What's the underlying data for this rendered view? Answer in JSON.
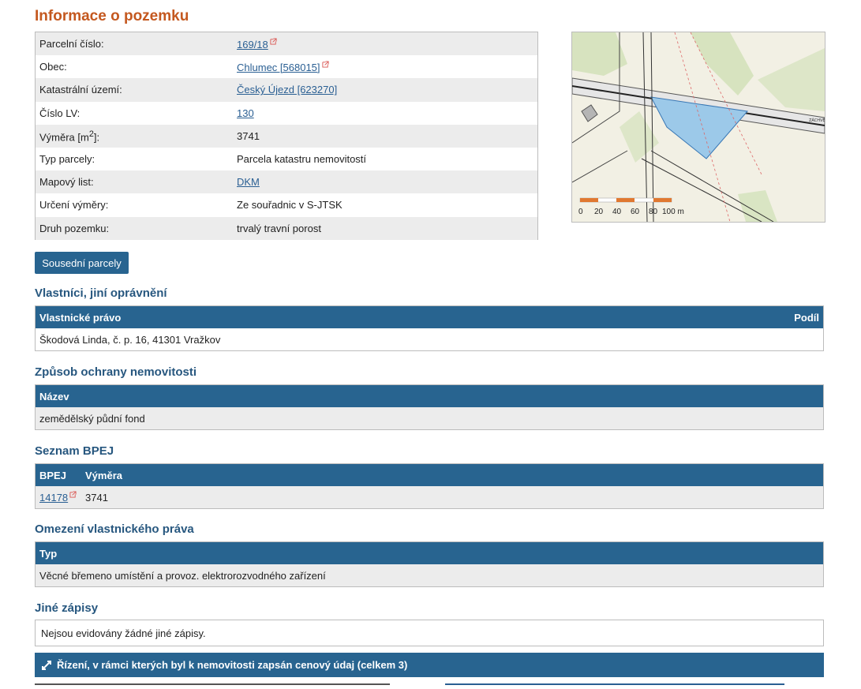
{
  "title": "Informace o pozemku",
  "info": [
    {
      "label": "Parcelní číslo:",
      "value": "169/18",
      "link": true,
      "ext": true
    },
    {
      "label": "Obec:",
      "value": "Chlumec [568015]",
      "link": true,
      "ext": true
    },
    {
      "label": "Katastrální území:",
      "value": "Český Újezd [623270]",
      "link": true,
      "ext": false
    },
    {
      "label": "Číslo LV:",
      "value": "130",
      "link": true,
      "ext": false
    },
    {
      "label": "Výměra [m",
      "sup": "2",
      "label_end": "]:",
      "value": "3741",
      "link": false,
      "ext": false
    },
    {
      "label": "Typ parcely:",
      "value": "Parcela katastru nemovitostí",
      "link": false,
      "ext": false
    },
    {
      "label": "Mapový list:",
      "value": "DKM",
      "link": true,
      "ext": false
    },
    {
      "label": "Určení výměry:",
      "value": "Ze souřadnic v S-JTSK",
      "link": false,
      "ext": false
    },
    {
      "label": "Druh pozemku:",
      "value": "trvalý travní porost",
      "link": false,
      "ext": false
    }
  ],
  "map": {
    "scale_labels": [
      "0",
      "20",
      "40",
      "60",
      "80",
      "100 m"
    ],
    "road_label": "ZÁCHVĚT",
    "colors": {
      "parcel": "#9cc9e9",
      "greenery": "#cfe0b5",
      "background": "#f2f0e4"
    }
  },
  "neighbors_button": "Sousední parcely",
  "owners": {
    "heading": "Vlastníci, jiní oprávnění",
    "col_right": "Vlastnické právo",
    "col_share": "Podíl",
    "rows": [
      "Škodová Linda, č. p. 16, 41301 Vražkov"
    ]
  },
  "protection": {
    "heading": "Způsob ochrany nemovitosti",
    "col": "Název",
    "rows": [
      "zemědělský půdní fond"
    ]
  },
  "bpej": {
    "heading": "Seznam BPEJ",
    "cols": [
      "BPEJ",
      "Výměra"
    ],
    "rows": [
      {
        "code": "14178",
        "area": "3741"
      }
    ]
  },
  "restrictions": {
    "heading": "Omezení vlastnického práva",
    "col": "Typ",
    "rows": [
      "Věcné břemeno umístění a provoz. elektrorozvodného zařízení"
    ]
  },
  "other": {
    "heading": "Jiné zápisy",
    "text": "Nejsou evidovány žádné jiné zápisy."
  },
  "proceedings": {
    "header": "Řízení, v rámci kterých byl k nemovitosti zapsán cenový údaj (celkem 3)"
  },
  "colors": {
    "accent": "#286490",
    "title": "#c4581f",
    "link": "#2a5f93",
    "ext_icon": "#d9534f"
  }
}
